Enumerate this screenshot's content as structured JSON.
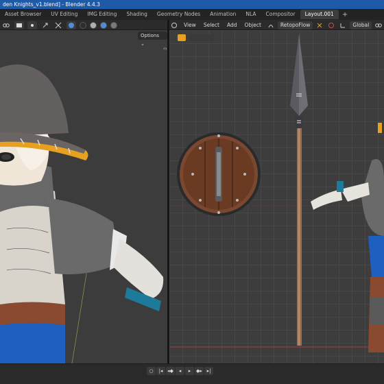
{
  "window": {
    "title": "den Knights_v1.blend] - Blender 4.4.3"
  },
  "tabs": [
    {
      "label": "Asset Browser"
    },
    {
      "label": "UV Editing"
    },
    {
      "label": "IMG Editing"
    },
    {
      "label": "Shading"
    },
    {
      "label": "Geometry Nodes"
    },
    {
      "label": "Animation"
    },
    {
      "label": "NLA"
    },
    {
      "label": "Compositor"
    },
    {
      "label": "Layout.001"
    }
  ],
  "tab_add": "+",
  "left_view": {
    "options_label": "Options ⌄"
  },
  "right_view": {
    "menus": [
      "View",
      "Select",
      "Add",
      "Object"
    ],
    "retopoflow_label": "RetopoFlow",
    "transform_orientation": "Global"
  },
  "colors": {
    "accent": "#1f5aa8",
    "header": "#2b2b2b",
    "viewport": "#3c3c3c"
  },
  "icons": {
    "play": "play-icon",
    "jump_start": "jump-start-icon",
    "jump_end": "jump-end-icon"
  }
}
